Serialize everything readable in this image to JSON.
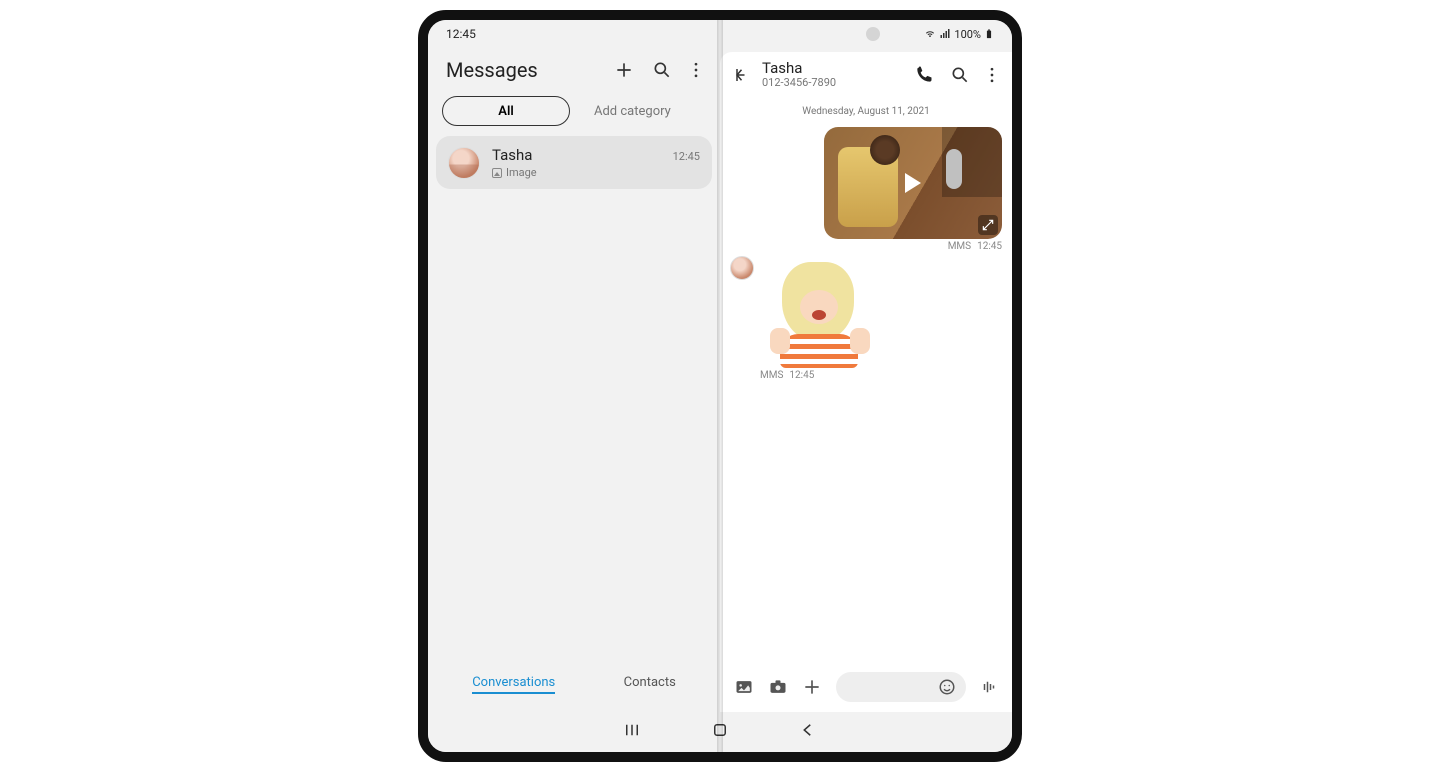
{
  "status_bar": {
    "time": "12:45",
    "battery_text": "100%"
  },
  "left": {
    "title": "Messages",
    "tab_all": "All",
    "add_category": "Add category",
    "conversation": {
      "name": "Tasha",
      "time": "12:45",
      "subtitle": "Image"
    },
    "bottom": {
      "conversations": "Conversations",
      "contacts": "Contacts"
    }
  },
  "right": {
    "name": "Tasha",
    "number": "012-3456-7890",
    "date": "Wednesday, August 11, 2021",
    "msg_out": {
      "type": "video",
      "tag": "MMS",
      "time": "12:45"
    },
    "msg_in": {
      "type": "sticker",
      "tag": "MMS",
      "time": "12:45"
    }
  }
}
